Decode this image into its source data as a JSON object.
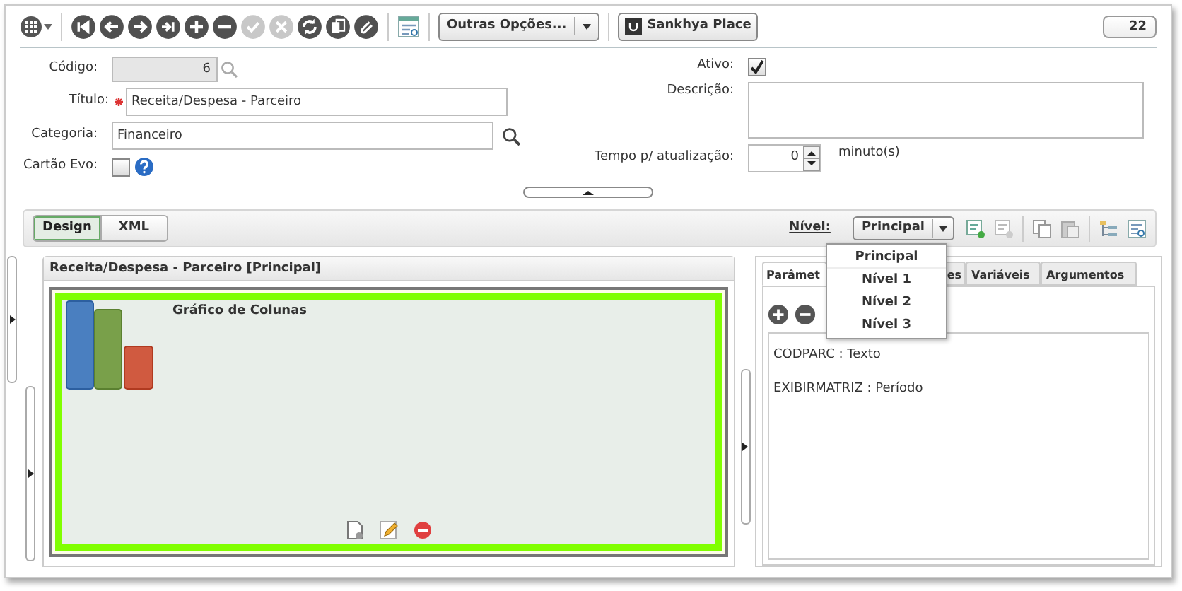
{
  "toolbar": {
    "nav_buttons": [
      {
        "kind": "first",
        "disabled": false
      },
      {
        "kind": "prev",
        "disabled": false
      },
      {
        "kind": "next",
        "disabled": false
      },
      {
        "kind": "last",
        "disabled": false
      },
      {
        "kind": "add",
        "disabled": false
      },
      {
        "kind": "remove",
        "disabled": false
      },
      {
        "kind": "confirm",
        "disabled": true
      },
      {
        "kind": "cancel",
        "disabled": true
      },
      {
        "kind": "refresh",
        "disabled": false
      },
      {
        "kind": "copy",
        "disabled": false
      },
      {
        "kind": "attach",
        "disabled": false
      }
    ],
    "more_options": "Outras Opções...",
    "place_button": "Sankhya Place",
    "badge": "22"
  },
  "form": {
    "codigo": {
      "label": "Código:",
      "value": "6"
    },
    "titulo": {
      "label": "Título:",
      "value": "Receita/Despesa - Parceiro",
      "required": true
    },
    "categoria": {
      "label": "Categoria:",
      "value": "Financeiro"
    },
    "cartao_evo": {
      "label": "Cartão Evo:",
      "checked": false
    },
    "ativo": {
      "label": "Ativo:",
      "checked": true
    },
    "descricao": {
      "label": "Descrição:"
    },
    "tempo": {
      "label": "Tempo p/ atualização:",
      "value": "0",
      "unit": "minuto(s)"
    }
  },
  "design_bar": {
    "tabs": [
      {
        "label": "Design",
        "selected": true
      },
      {
        "label": "XML",
        "selected": false
      }
    ],
    "level_label": "Nível:",
    "level_value": "Principal",
    "level_menu": [
      {
        "label": "Principal",
        "selected": true
      },
      {
        "label": "Nível 1",
        "selected": false
      },
      {
        "label": "Nível 2",
        "selected": false
      },
      {
        "label": "Nível 3",
        "selected": false
      }
    ]
  },
  "left_panel": {
    "title": "Receita/Despesa - Parceiro [Principal]",
    "component_title": "Gráfico de Colunas"
  },
  "right_panel": {
    "tabs": [
      {
        "label": "Parâmet",
        "selected": true
      },
      {
        "label": "es",
        "selected": false
      },
      {
        "label": "Variáveis",
        "selected": false
      },
      {
        "label": "Argumentos",
        "selected": false
      }
    ],
    "items": [
      "CODPARC : Texto",
      "EXIBIRMATRIZ : Período"
    ]
  }
}
